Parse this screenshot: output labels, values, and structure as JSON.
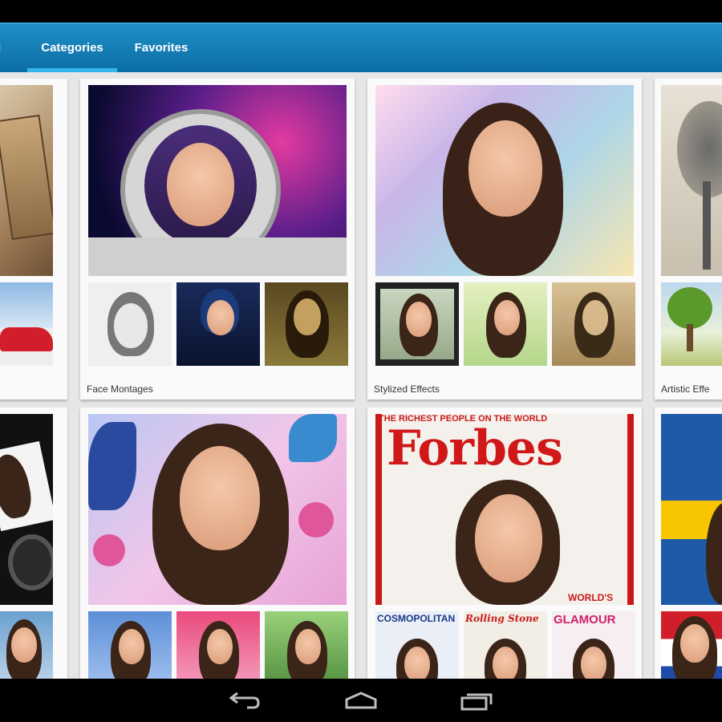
{
  "tabs": [
    {
      "label": "d"
    },
    {
      "label": "Categories",
      "selected": true
    },
    {
      "label": "Favorites"
    }
  ],
  "cards": [
    {
      "label": ""
    },
    {
      "label": "Face Montages"
    },
    {
      "label": "Stylized Effects"
    },
    {
      "label": "Artistic Effe"
    },
    {
      "label": ""
    },
    {
      "label": ""
    },
    {
      "label": ""
    },
    {
      "label": ""
    }
  ],
  "magazines": {
    "forbes_banner": "THE RICHEST PEOPLE ON THE WORLD",
    "forbes_title": "Forbes",
    "forbes_worlds": "WORLD'S",
    "thumb1": "COSMOPOLITAN",
    "thumb2": "Rolling Stone",
    "thumb3": "GLAMOUR"
  },
  "nav": {
    "back": "back-icon",
    "home": "home-icon",
    "recents": "recents-icon"
  },
  "colors": {
    "accent": "#36b5ea",
    "tab_bar": "#0b6ea4",
    "background": "#e6e6e6"
  }
}
